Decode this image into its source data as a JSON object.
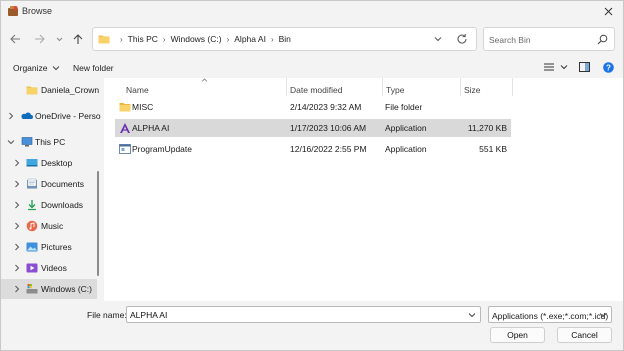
{
  "window": {
    "title": "Browse"
  },
  "address": {
    "crumbs": [
      "This PC",
      "Windows (C:)",
      "Alpha AI",
      "Bin"
    ]
  },
  "search": {
    "placeholder": "Search Bin"
  },
  "toolbar": {
    "organize_label": "Organize",
    "new_folder_label": "New folder"
  },
  "sidebar": {
    "items": [
      {
        "label": "Daniela_Crown",
        "icon": "folder-icon"
      },
      {
        "label": "OneDrive - Perso",
        "icon": "onedrive-icon"
      },
      {
        "label": "This PC",
        "icon": "pc-icon"
      },
      {
        "label": "Desktop",
        "icon": "desktop-icon"
      },
      {
        "label": "Documents",
        "icon": "documents-icon"
      },
      {
        "label": "Downloads",
        "icon": "downloads-icon"
      },
      {
        "label": "Music",
        "icon": "music-icon"
      },
      {
        "label": "Pictures",
        "icon": "pictures-icon"
      },
      {
        "label": "Videos",
        "icon": "videos-icon"
      },
      {
        "label": "Windows (C:)",
        "icon": "drive-icon"
      }
    ]
  },
  "filelist": {
    "columns": {
      "name": "Name",
      "date": "Date modified",
      "type": "Type",
      "size": "Size"
    },
    "rows": [
      {
        "name": "MISC",
        "date": "2/14/2023 9:32 AM",
        "type": "File folder",
        "size": "",
        "icon": "folder-icon"
      },
      {
        "name": "ALPHA AI",
        "date": "1/17/2023 10:06 AM",
        "type": "Application",
        "size": "11,270 KB",
        "icon": "alpha-app-icon"
      },
      {
        "name": "ProgramUpdate",
        "date": "12/16/2022 2:55 PM",
        "type": "Application",
        "size": "551 KB",
        "icon": "exe-icon"
      }
    ]
  },
  "footer": {
    "filename_label": "File name:",
    "filename_value": "ALPHA AI",
    "filetype_value": "Applications (*.exe;*.com;*.icd)",
    "open_label": "Open",
    "cancel_label": "Cancel"
  },
  "colors": {
    "accent": "#0067c0",
    "selected_row": "#d9d9d9",
    "folder": "#f0c24b"
  }
}
